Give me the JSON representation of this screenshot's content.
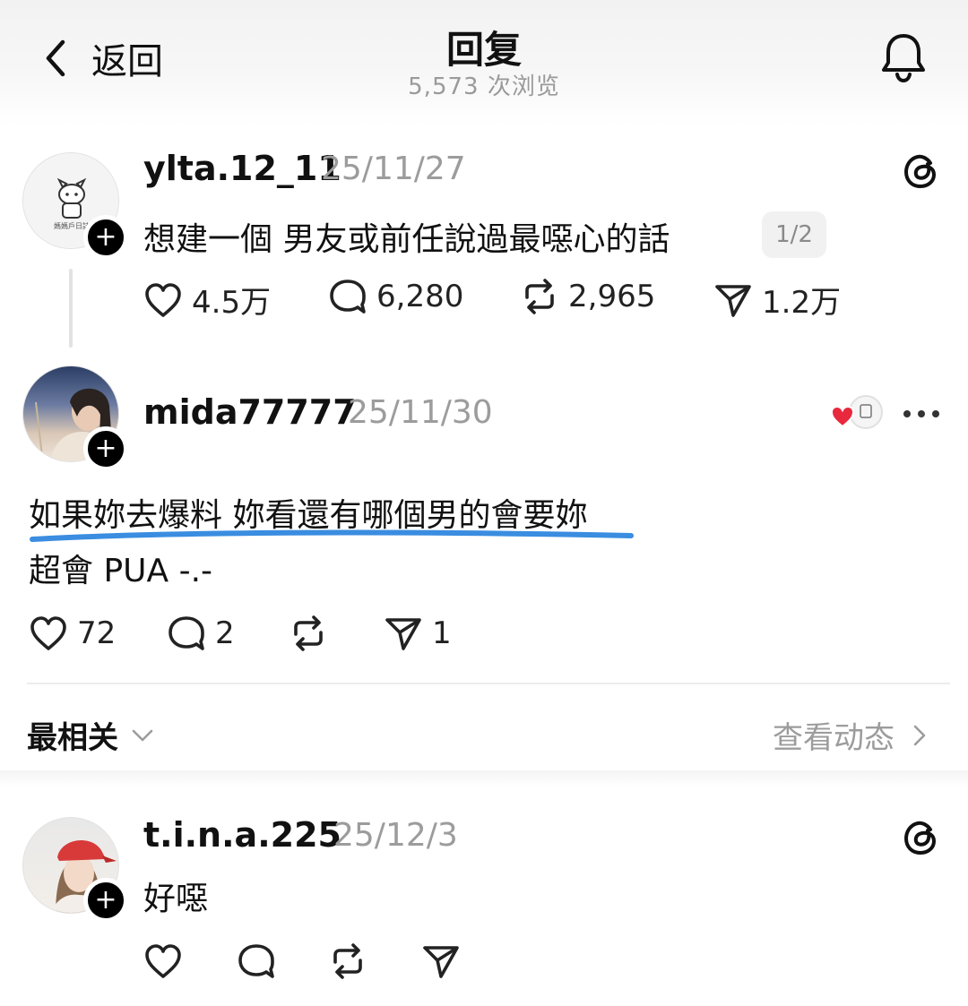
{
  "header": {
    "back_label": "返回",
    "title": "回复",
    "views": "5,573 次浏览"
  },
  "root_post": {
    "username": "ylta.12_11",
    "date": "25/11/27",
    "text": "想建一個 男友或前任說過最噁心的話",
    "page_indicator": "1/2",
    "avatar_text": "媽媽戶日誌",
    "stats": {
      "likes": "4.5万",
      "replies": "6,280",
      "reposts": "2,965",
      "shares": "1.2万"
    }
  },
  "reply": {
    "username": "mida77777",
    "date": "25/11/30",
    "line1": "如果妳去爆料 妳看還有哪個男的會要妳",
    "line2": "超會 PUA -.-",
    "stats": {
      "likes": "72",
      "replies": "2",
      "reposts": "",
      "shares": "1"
    },
    "underline_color": "#3a8de0"
  },
  "sort_bar": {
    "sort_label": "最相关",
    "activity_label": "查看动态"
  },
  "comment": {
    "username": "t.i.n.a.225",
    "date": "25/12/3",
    "text": "好噁"
  },
  "colors": {
    "liked_heart": "#e8283c",
    "muted_text": "#9c9c9c",
    "underline": "#3a8de0"
  },
  "icons": [
    "chevron-left-icon",
    "bell-icon",
    "threads-logo-icon",
    "heart-icon",
    "comment-icon",
    "repost-icon",
    "share-icon",
    "more-icon",
    "chevron-down-icon",
    "chevron-right-icon"
  ]
}
